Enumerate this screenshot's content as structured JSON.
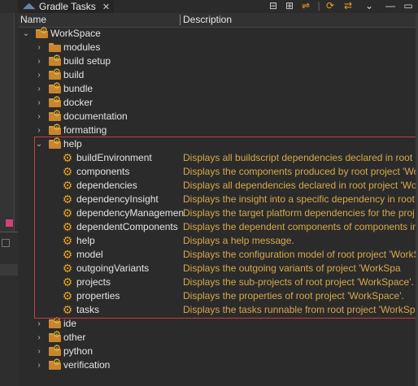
{
  "tab": {
    "title": "Gradle Tasks",
    "close_icon": "✕"
  },
  "columns": {
    "name": "Name",
    "description": "Description"
  },
  "tree": {
    "root": "WorkSpace",
    "groups_before": [
      "modules",
      "build setup",
      "build",
      "bundle",
      "docker",
      "documentation",
      "formatting"
    ],
    "help": {
      "label": "help",
      "tasks": [
        {
          "name": "buildEnvironment",
          "desc": "Displays all buildscript dependencies declared in root p"
        },
        {
          "name": "components",
          "desc": "Displays the components produced by root project 'Wo"
        },
        {
          "name": "dependencies",
          "desc": "Displays all dependencies declared in root project 'Wo"
        },
        {
          "name": "dependencyInsight",
          "desc": "Displays the insight into a specific dependency in root"
        },
        {
          "name": "dependencyManagemen",
          "desc": "Displays the target platform dependencies for the proj"
        },
        {
          "name": "dependentComponents",
          "desc": "Displays the dependent components of components in"
        },
        {
          "name": "help",
          "desc": "Displays a help message."
        },
        {
          "name": "model",
          "desc": "Displays the configuration model of root project 'WorkS"
        },
        {
          "name": "outgoingVariants",
          "desc": "Displays the outgoing variants of project 'WorkSpa"
        },
        {
          "name": "projects",
          "desc": "Displays the sub-projects of root project 'WorkSpace'."
        },
        {
          "name": "properties",
          "desc": "Displays the properties of root project 'WorkSpace'."
        },
        {
          "name": "tasks",
          "desc": "Displays the tasks runnable from root project 'WorkSpa"
        }
      ]
    },
    "groups_after": [
      "ide",
      "other",
      "python",
      "verification"
    ]
  },
  "colors": {
    "task_desc": "#d7a84a",
    "highlight_border": "#cc3b3b",
    "gear": "#e6a21d"
  }
}
